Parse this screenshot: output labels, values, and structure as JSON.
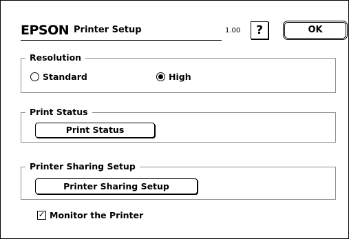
{
  "header": {
    "brand": "EPSON",
    "title": "Printer Setup",
    "version": "1.00",
    "help_label": "?",
    "ok_label": "OK"
  },
  "resolution": {
    "group_label": "Resolution",
    "options": [
      {
        "label": "Standard",
        "selected": false
      },
      {
        "label": "High",
        "selected": true
      }
    ]
  },
  "print_status": {
    "group_label": "Print Status",
    "button_label": "Print Status"
  },
  "sharing": {
    "group_label": "Printer Sharing Setup",
    "button_label": "Printer Sharing Setup"
  },
  "monitor": {
    "label": "Monitor the Printer",
    "checked": true,
    "check_glyph": "✓"
  }
}
